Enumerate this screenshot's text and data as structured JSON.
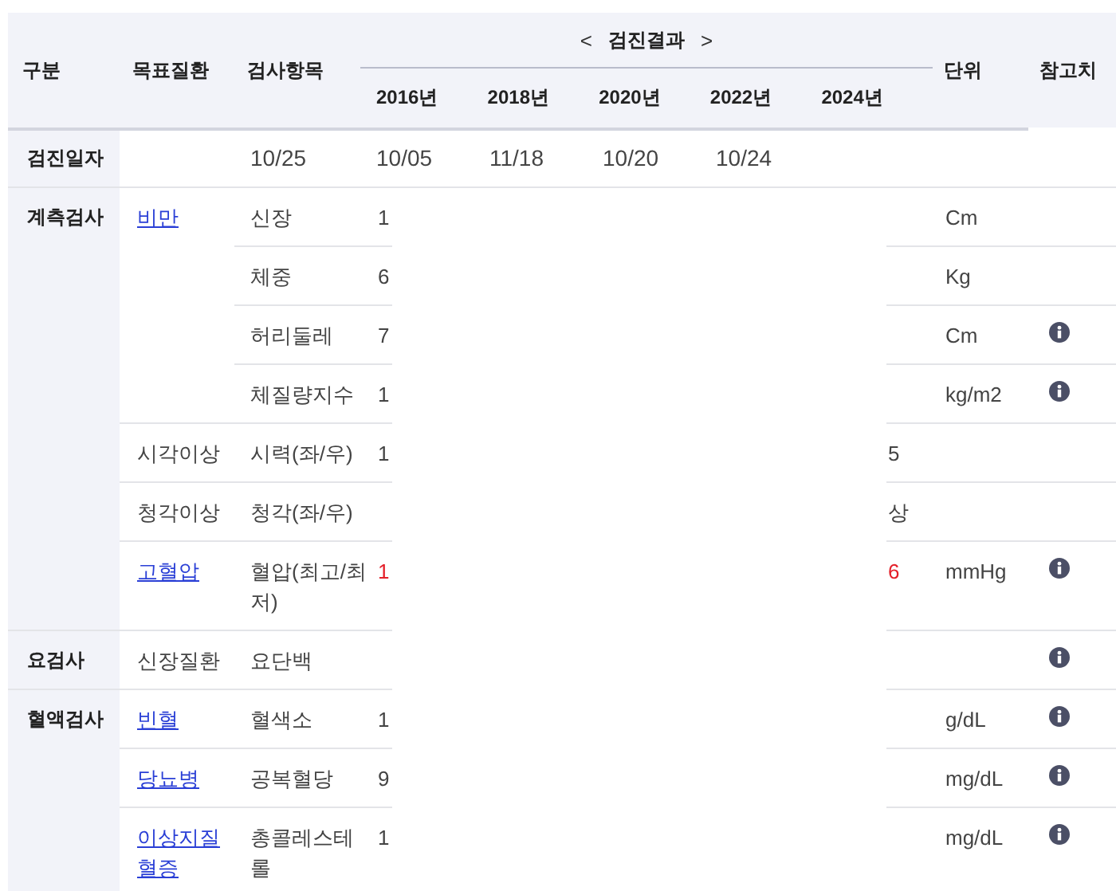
{
  "header": {
    "category": "구분",
    "disease": "목표질환",
    "item": "검사항목",
    "prev": "<",
    "results_title": "검진결과",
    "next": ">",
    "years": [
      "2016년",
      "2018년",
      "2020년",
      "2022년",
      "2024년"
    ],
    "unit": "단위",
    "reference": "참고치"
  },
  "date_row": {
    "label": "검진일자",
    "values": [
      "10/25",
      "10/05",
      "11/18",
      "10/20",
      "10/24"
    ]
  },
  "groups": [
    {
      "category": "계측검사",
      "diseases": [
        {
          "name": "비만",
          "link": true,
          "tests": [
            {
              "name": "신장",
              "left": {
                "text": "1",
                "alert": false
              },
              "unit": "Cm",
              "info": false
            },
            {
              "name": "체중",
              "left": {
                "text": "6",
                "alert": false
              },
              "unit": "Kg",
              "info": false
            },
            {
              "name": "허리둘레",
              "left": {
                "text": "7",
                "alert": false
              },
              "unit": "Cm",
              "info": true
            },
            {
              "name": "체질량지수",
              "left": {
                "text": "1",
                "alert": false
              },
              "unit": "kg/m2",
              "info": true
            }
          ]
        },
        {
          "name": "시각이상",
          "link": false,
          "tests": [
            {
              "name": "시력(좌/우)",
              "left": {
                "text": "1",
                "alert": false
              },
              "right": {
                "text": "5",
                "alert": false
              },
              "info": false
            }
          ]
        },
        {
          "name": "청각이상",
          "link": false,
          "tests": [
            {
              "name": "청각(좌/우)",
              "right": {
                "text": "상",
                "alert": false
              },
              "info": false
            }
          ]
        },
        {
          "name": "고혈압",
          "link": true,
          "tests": [
            {
              "name": "혈압(최고/최저)",
              "left": {
                "text": "1",
                "alert": true
              },
              "right": {
                "text": "6",
                "alert": true
              },
              "unit": "mmHg",
              "info": true
            }
          ]
        }
      ]
    },
    {
      "category": "요검사",
      "diseases": [
        {
          "name": "신장질환",
          "link": false,
          "tests": [
            {
              "name": "요단백",
              "info": true
            }
          ]
        }
      ]
    },
    {
      "category": "혈액검사",
      "diseases": [
        {
          "name": "빈혈",
          "link": true,
          "tests": [
            {
              "name": "혈색소",
              "left": {
                "text": "1",
                "alert": false
              },
              "unit": "g/dL",
              "info": true
            }
          ]
        },
        {
          "name": "당뇨병",
          "link": true,
          "tests": [
            {
              "name": "공복혈당",
              "left": {
                "text": "9",
                "alert": false
              },
              "unit": "mg/dL",
              "info": true
            }
          ]
        },
        {
          "name": "이상지질혈증",
          "link": true,
          "tests": [
            {
              "name": "총콜레스테롤",
              "left": {
                "text": "1",
                "alert": false
              },
              "unit": "mg/dL",
              "info": true
            }
          ]
        }
      ]
    }
  ]
}
